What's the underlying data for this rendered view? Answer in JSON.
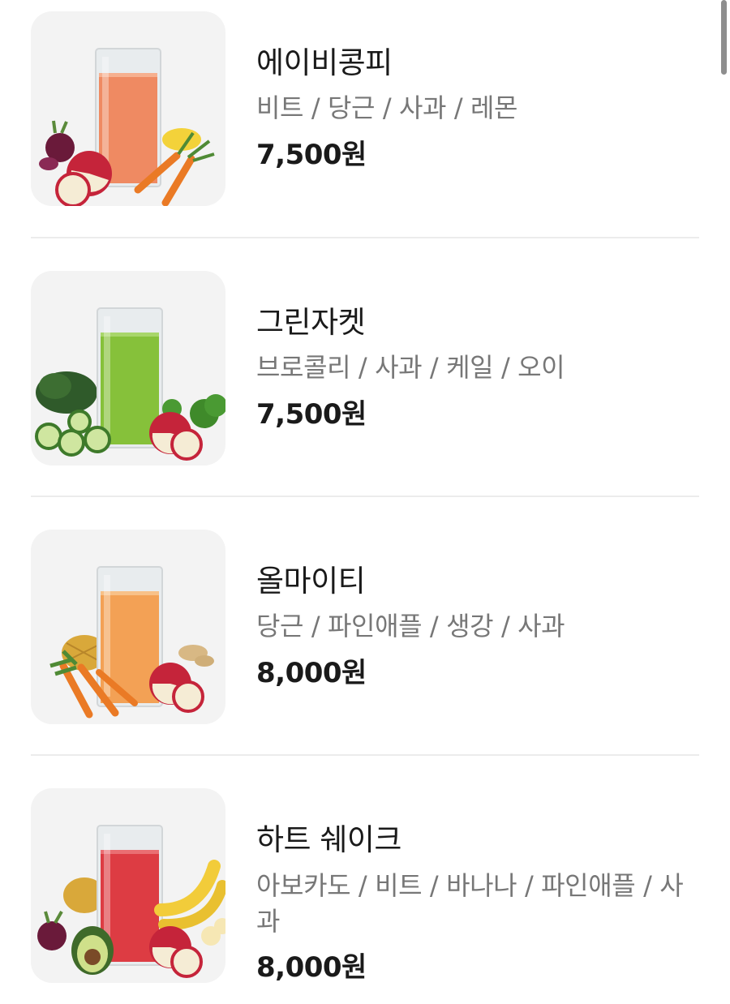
{
  "menu": {
    "items": [
      {
        "name": "에이비콩피",
        "ingredients": "비트 / 당근 / 사과 / 레몬",
        "price": "7,500원",
        "juice_color": "#ef8a62",
        "image_icon": "abc-juice-glass-icon"
      },
      {
        "name": "그린자켓",
        "ingredients": "브로콜리 / 사과 / 케일 / 오이",
        "price": "7,500원",
        "juice_color": "#86c13a",
        "image_icon": "green-juice-glass-icon"
      },
      {
        "name": "올마이티",
        "ingredients": "당근 / 파인애플 / 생강 / 사과",
        "price": "8,000원",
        "juice_color": "#f3a155",
        "image_icon": "orange-juice-glass-icon"
      },
      {
        "name": "하트 쉐이크",
        "ingredients": "아보카도 / 비트 / 바나나 / 파인애플 / 사과",
        "price": "8,000원",
        "juice_color": "#dd3c43",
        "image_icon": "red-juice-glass-icon"
      }
    ]
  },
  "colors": {
    "text_primary": "#1a1a1a",
    "text_secondary": "#777777",
    "thumb_background": "#f3f3f3",
    "divider": "#ececec",
    "scrollbar": "#8e8e8e"
  }
}
